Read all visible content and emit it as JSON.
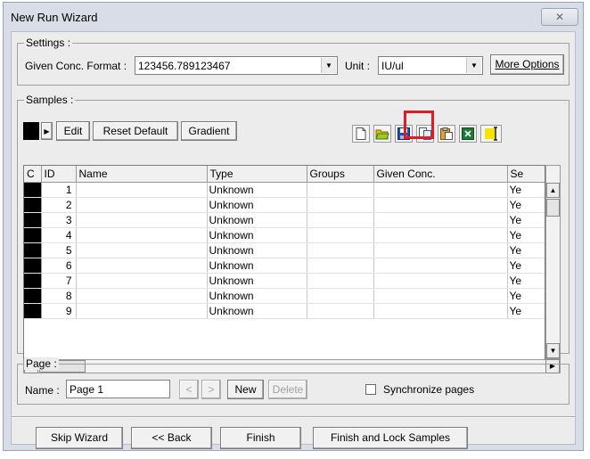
{
  "window": {
    "title": "New Run Wizard",
    "close_glyph": "✕"
  },
  "settings": {
    "group_label": "Settings :",
    "format_label": "Given Conc. Format :",
    "format_value": "123456.789123467",
    "unit_label": "Unit :",
    "unit_value": "IU/ul",
    "more_options_label": "More Options"
  },
  "samples": {
    "group_label": "Samples :",
    "edit_label": "Edit",
    "reset_default_label": "Reset Default",
    "gradient_label": "Gradient",
    "toolbar_icons": [
      "new-file-icon",
      "open-folder-icon",
      "save-icon",
      "copy-icon",
      "paste-icon",
      "excel-icon",
      "color-marker-icon"
    ],
    "highlight_color": "#e01b24",
    "columns": [
      "C",
      "ID",
      "Name",
      "Type",
      "Groups",
      "Given Conc.",
      "Se"
    ],
    "rows": [
      {
        "id": "1",
        "name": "",
        "type": "Unknown",
        "groups": "",
        "conc": "",
        "se": "Ye"
      },
      {
        "id": "2",
        "name": "",
        "type": "Unknown",
        "groups": "",
        "conc": "",
        "se": "Ye"
      },
      {
        "id": "3",
        "name": "",
        "type": "Unknown",
        "groups": "",
        "conc": "",
        "se": "Ye"
      },
      {
        "id": "4",
        "name": "",
        "type": "Unknown",
        "groups": "",
        "conc": "",
        "se": "Ye"
      },
      {
        "id": "5",
        "name": "",
        "type": "Unknown",
        "groups": "",
        "conc": "",
        "se": "Ye"
      },
      {
        "id": "6",
        "name": "",
        "type": "Unknown",
        "groups": "",
        "conc": "",
        "se": "Ye"
      },
      {
        "id": "7",
        "name": "",
        "type": "Unknown",
        "groups": "",
        "conc": "",
        "se": "Ye"
      },
      {
        "id": "8",
        "name": "",
        "type": "Unknown",
        "groups": "",
        "conc": "",
        "se": "Ye"
      },
      {
        "id": "9",
        "name": "",
        "type": "Unknown",
        "groups": "",
        "conc": "",
        "se": "Ye"
      }
    ]
  },
  "page": {
    "group_label": "Page :",
    "name_label": "Name :",
    "name_value": "Page 1",
    "prev_glyph": "<",
    "next_glyph": ">",
    "new_label": "New",
    "delete_label": "Delete",
    "sync_label": "Synchronize pages"
  },
  "footer": {
    "skip_wizard_label": "Skip Wizard",
    "back_label": "<< Back",
    "finish_label": "Finish",
    "finish_lock_label": "Finish and Lock Samples"
  }
}
